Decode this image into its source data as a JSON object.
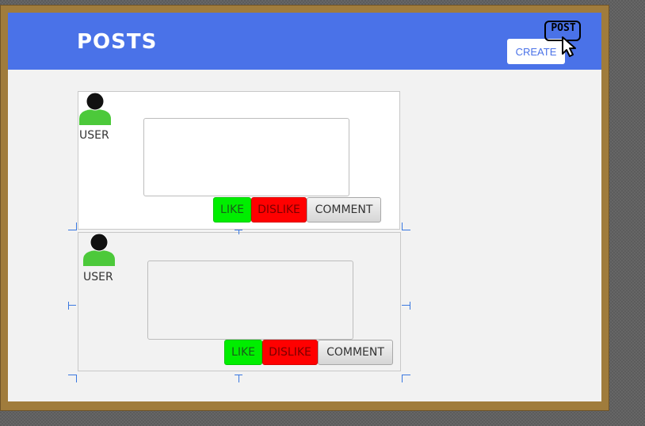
{
  "header": {
    "title": "POSTS",
    "create_label": "CREATE",
    "post_icon_text": "POST",
    "background": "#4a72e8"
  },
  "posts": [
    {
      "user_label": "USER",
      "text": "",
      "like_label": "LIKE",
      "dislike_label": "DISLIKE",
      "comment_label": "COMMENT"
    },
    {
      "user_label": "USER",
      "text": "",
      "like_label": "LIKE",
      "dislike_label": "DISLIKE",
      "comment_label": "COMMENT"
    }
  ],
  "colors": {
    "like": "#00ee00",
    "dislike": "#ff0000",
    "avatar_body": "#4cc93a",
    "avatar_head": "#111111",
    "frame": "#a07c3c"
  },
  "icons": [
    "user-avatar-icon",
    "post-cursor-icon"
  ]
}
